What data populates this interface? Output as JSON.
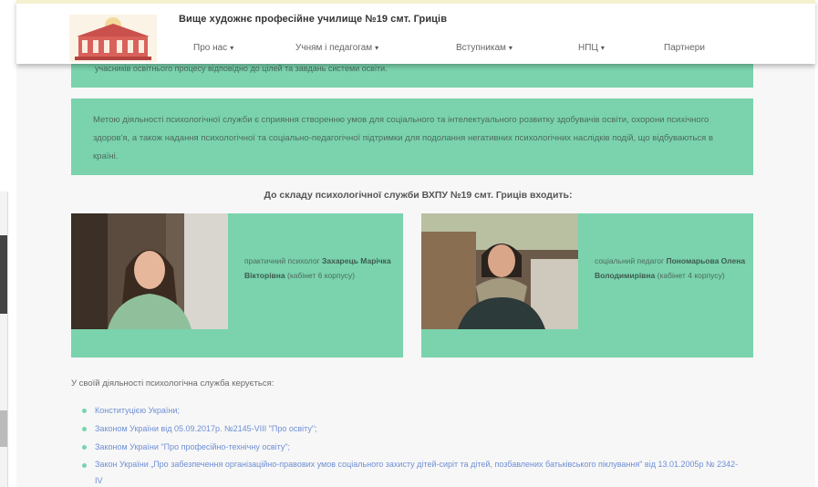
{
  "header": {
    "title": "Вище художнє професійне училище №19 смт. Гриців",
    "nav": [
      {
        "label": "Про нас",
        "caret": "▾"
      },
      {
        "label": "Учням і педагогам",
        "caret": "▾"
      },
      {
        "label": "Вступникам",
        "caret": "▾"
      },
      {
        "label": "НПЦ",
        "caret": "▾"
      },
      {
        "label": "Партнери",
        "caret": ""
      }
    ]
  },
  "content": {
    "top_line": "учасників освітнього процесу відповідно до цілей та завдань системи освіти.",
    "goal_text": "Метою діяльності психологічної служби є сприяння створенню умов для соціального та інтелектуального розвитку здобувачів освіти, охорони психічного здоров'я, а також надання психологічної та соціально-педагогічної підтримки для подолання негативних психологічних наслідків подій, що відбуваються в країні.",
    "staff_heading": "До складу психологічної служби ВХПУ №19 смт. Гриців входить:",
    "staff": [
      {
        "role": "практичний психолог",
        "name": "Захарець Марічка Вікторівна",
        "suffix": "(кабінет 6 корпусу)"
      },
      {
        "role": "соціальний педагог",
        "name": "Пономарьова Олена Володимирівна",
        "suffix": "(кабінет 4 корпусу)"
      }
    ],
    "laws_intro": "У своїй діяльності психологічна служба керується:",
    "laws": [
      "Конституцією України;",
      "Законом України від 05.09.2017р. №2145-VIII \"Про освіту\";",
      "Законом України \"Про професійно-технічну освіту\";",
      "Закон України „Про забезпечення організаційно-правових умов соціального захисту дітей-сиріт та дітей, позбавлених батьківського піклування\" від 13.01.2005р № 2342-IV"
    ]
  },
  "colors": {
    "accent_green": "#7ad3ad",
    "link_blue": "#6f8fd4"
  }
}
